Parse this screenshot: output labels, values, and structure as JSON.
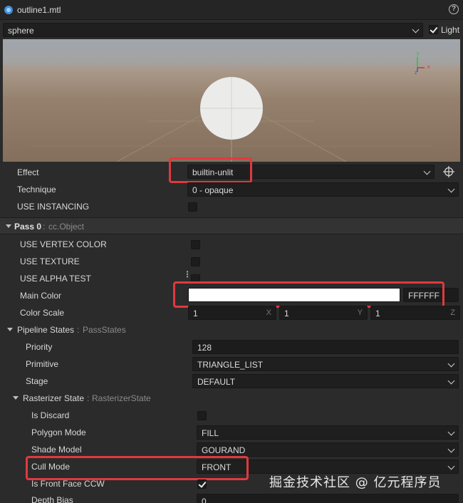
{
  "window": {
    "title": "outline1.mtl",
    "help_glyph": "?"
  },
  "preview": {
    "mesh": "sphere",
    "light_label": "Light",
    "light_checked": true,
    "gizmo_y": "y",
    "gizmo_x": "x",
    "gizmo_z": "z"
  },
  "effect": {
    "label": "Effect",
    "value": "builtin-unlit"
  },
  "technique": {
    "label": "Technique",
    "value": "0 - opaque"
  },
  "use_instancing": {
    "label": "USE INSTANCING",
    "checked": false
  },
  "pass": {
    "title": "Pass 0",
    "type": "cc.Object"
  },
  "use_vertex_color": {
    "label": "USE VERTEX COLOR",
    "checked": false
  },
  "use_texture": {
    "label": "USE TEXTURE",
    "checked": false
  },
  "use_alpha_test": {
    "label": "USE ALPHA TEST",
    "checked": false
  },
  "main_color": {
    "label": "Main Color",
    "hex": "FFFFFF",
    "swatch": "#ffffff"
  },
  "color_scale": {
    "label": "Color Scale",
    "x": "1",
    "y": "1",
    "z": "1",
    "x_axis": "X",
    "y_axis": "Y",
    "z_axis": "Z"
  },
  "pipeline_states": {
    "label": "Pipeline States",
    "type": "PassStates"
  },
  "priority": {
    "label": "Priority",
    "value": "128"
  },
  "primitive": {
    "label": "Primitive",
    "value": "TRIANGLE_LIST"
  },
  "stage": {
    "label": "Stage",
    "value": "DEFAULT"
  },
  "rasterizer_state": {
    "label": "Rasterizer State",
    "type": "RasterizerState"
  },
  "is_discard": {
    "label": "Is Discard",
    "checked": false
  },
  "polygon_mode": {
    "label": "Polygon Mode",
    "value": "FILL"
  },
  "shade_model": {
    "label": "Shade Model",
    "value": "GOURAND"
  },
  "cull_mode": {
    "label": "Cull Mode",
    "value": "FRONT"
  },
  "is_front_face_ccw": {
    "label": "Is Front Face CCW",
    "checked": true
  },
  "depth_bias": {
    "label": "Depth Bias",
    "value": "0"
  },
  "watermark": "掘金技术社区 @ 亿元程序员",
  "colors": {
    "highlight": "#e0393f",
    "panel": "#2b2b2b",
    "input": "#1c1c1c"
  }
}
